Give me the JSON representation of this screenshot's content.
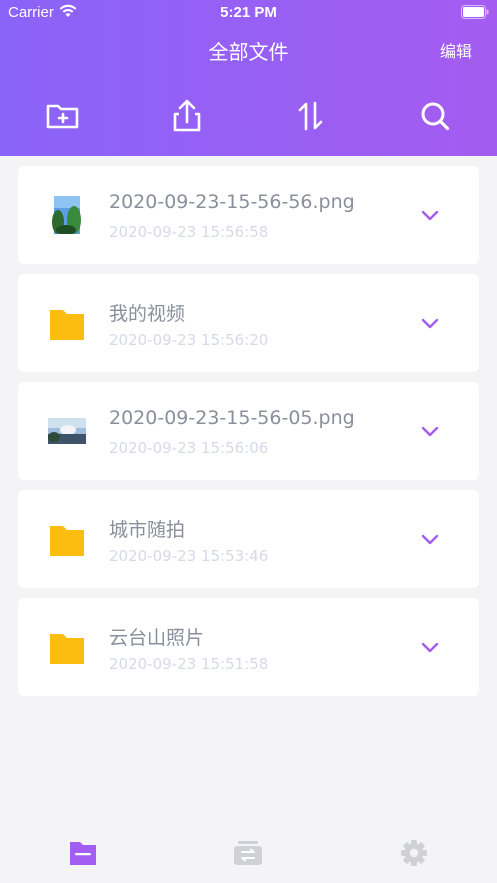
{
  "status_bar": {
    "carrier": "Carrier",
    "time": "5:21 PM"
  },
  "header": {
    "title": "全部文件",
    "edit_label": "编辑",
    "toolbar": [
      "new-folder-icon",
      "share-icon",
      "sort-icon",
      "search-icon"
    ]
  },
  "files": [
    {
      "name": "2020-09-23-15-56-56.png",
      "date": "2020-09-23 15:56:58",
      "kind": "image"
    },
    {
      "name": "我的视频",
      "date": "2020-09-23 15:56:20",
      "kind": "folder"
    },
    {
      "name": "2020-09-23-15-56-05.png",
      "date": "2020-09-23 15:56:06",
      "kind": "image"
    },
    {
      "name": "城市随拍",
      "date": "2020-09-23 15:53:46",
      "kind": "folder"
    },
    {
      "name": "云台山照片",
      "date": "2020-09-23 15:51:58",
      "kind": "folder"
    }
  ],
  "tabs": [
    "files-tab-icon",
    "transfer-tab-icon",
    "settings-tab-icon"
  ],
  "colors": {
    "accent": "#a25df2",
    "folder": "#fbbd0f",
    "tab_inactive": "#cfd1d6"
  }
}
